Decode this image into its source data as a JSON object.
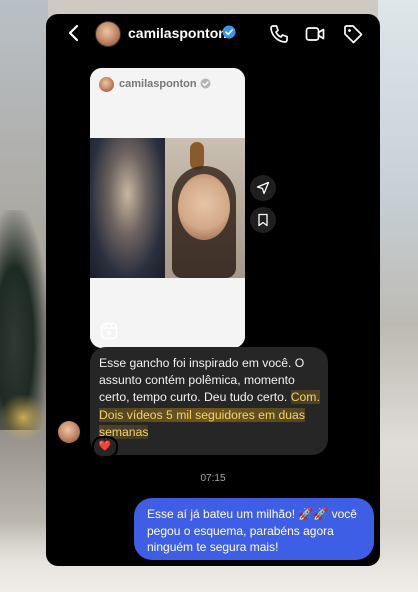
{
  "header": {
    "username": "camilasponton",
    "verified_icon": "verified-badge-icon",
    "icons": [
      "back-chevron-icon",
      "phone-icon",
      "video-camera-icon",
      "tag-icon"
    ]
  },
  "shared_post": {
    "username": "camilasponton",
    "type_icon": "reels-icon"
  },
  "side_actions": [
    "share-icon",
    "save-bookmark-icon"
  ],
  "messages": {
    "received": {
      "text_part1": "Esse gancho foi inspirado em você. O assunto contém polêmica, momento certo, tempo curto. Deu tudo certo. ",
      "text_highlight": "Com. Dois vídeos 5 mil seguidores em duas semanas",
      "reaction": "❤️"
    },
    "timestamp": "07:15",
    "sent": {
      "text": "Esse aí já bateu um milhão! 🚀🚀 você pegou o esquema, parabéns agora ninguém te segura mais!"
    }
  },
  "colors": {
    "panel": "#000000",
    "received_bubble": "#262626",
    "sent_bubble": "#3f5ee6",
    "highlight_text": "#f5d36b"
  }
}
